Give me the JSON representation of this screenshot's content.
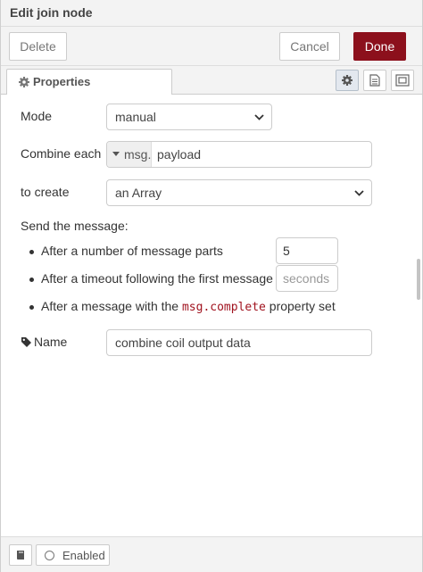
{
  "tray": {
    "title": "Edit join node"
  },
  "toolbar": {
    "delete_label": "Delete",
    "cancel_label": "Cancel",
    "done_label": "Done"
  },
  "tabs": {
    "properties_label": "Properties"
  },
  "form": {
    "mode": {
      "label": "Mode",
      "value": "manual"
    },
    "combine": {
      "label": "Combine each",
      "prefix": "msg.",
      "value": "payload"
    },
    "create": {
      "label": "to create",
      "value": "an Array"
    },
    "send_label": "Send the message:",
    "bullets": {
      "parts_label": "After a number of message parts",
      "parts_value": "5",
      "timeout_label": "After a timeout following the first message",
      "timeout_placeholder": "seconds",
      "complete_before": "After a message with the",
      "complete_code": "msg.complete",
      "complete_after": "property set"
    },
    "name": {
      "label": "Name",
      "value": "combine coil output data"
    }
  },
  "footer": {
    "enabled_label": "Enabled"
  },
  "icons": [
    "cog-icon",
    "description-icon",
    "appearance-icon",
    "tag-icon",
    "book-icon",
    "radio-icon",
    "chevron-down-icon"
  ]
}
